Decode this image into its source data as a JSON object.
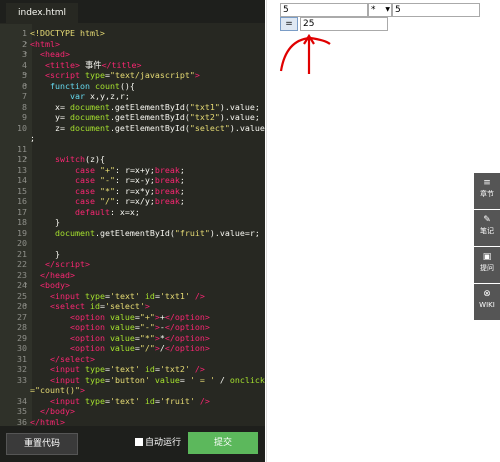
{
  "tab": {
    "filename": "index.html"
  },
  "code_lines": [
    {
      "num": "1",
      "fold": "",
      "html": "<span class=\"str\">&lt;!DOCTYPE html&gt;</span>"
    },
    {
      "num": "2",
      "fold": "▾",
      "html": "<span class=\"tag\">&lt;html&gt;</span>"
    },
    {
      "num": "3",
      "fold": "▾",
      "html": "  <span class=\"tag\">&lt;head&gt;</span>"
    },
    {
      "num": "4",
      "fold": "",
      "html": "   <span class=\"tag\">&lt;title&gt;</span> 事件<span class=\"tag\">&lt;/title&gt;</span>"
    },
    {
      "num": "5",
      "fold": "▾",
      "html": "   <span class=\"tag\">&lt;script</span> <span class=\"attr\">type</span>=<span class=\"str\">\"text/javascript\"</span><span class=\"tag\">&gt;</span>"
    },
    {
      "num": "6",
      "fold": "▾",
      "html": "    <span class=\"fn\">function</span> <span class=\"attr\">count</span>(){"
    },
    {
      "num": "7",
      "fold": "",
      "html": "        <span class=\"fn\">var</span> x,y,z,r;"
    },
    {
      "num": "8",
      "fold": "",
      "html": "     x= <span class=\"attr\">document</span>.getElementById(<span class=\"str\">\"txt1\"</span>).value;"
    },
    {
      "num": "9",
      "fold": "",
      "html": "     y= <span class=\"attr\">document</span>.getElementById(<span class=\"str\">\"txt2\"</span>).value;"
    },
    {
      "num": "10",
      "fold": "",
      "html": "     z= <span class=\"attr\">document</span>.getElementById(<span class=\"str\">\"select\"</span>).value"
    },
    {
      "num": "",
      "fold": "",
      "html": ";"
    },
    {
      "num": "11",
      "fold": "",
      "html": ""
    },
    {
      "num": "12",
      "fold": "▾",
      "html": "     <span class=\"tag\">switch</span>(z){"
    },
    {
      "num": "13",
      "fold": "",
      "html": "         <span class=\"tag\">case</span> <span class=\"str\">\"+\"</span>: r=x+y;<span class=\"tag\">break</span>;"
    },
    {
      "num": "14",
      "fold": "",
      "html": "         <span class=\"tag\">case</span> <span class=\"str\">\"-\"</span>: r=x-y;<span class=\"tag\">break</span>;"
    },
    {
      "num": "15",
      "fold": "",
      "html": "         <span class=\"tag\">case</span> <span class=\"str\">\"*\"</span>: r=x*y;<span class=\"tag\">break</span>;"
    },
    {
      "num": "16",
      "fold": "",
      "html": "         <span class=\"tag\">case</span> <span class=\"str\">\"/\"</span>: r=x/y;<span class=\"tag\">break</span>;"
    },
    {
      "num": "17",
      "fold": "",
      "html": "         <span class=\"tag\">default</span>: x=x;"
    },
    {
      "num": "18",
      "fold": "",
      "html": "     }"
    },
    {
      "num": "19",
      "fold": "",
      "html": "     <span class=\"attr\">document</span>.getElementById(<span class=\"str\">\"fruit\"</span>).value=r;"
    },
    {
      "num": "20",
      "fold": "",
      "html": ""
    },
    {
      "num": "21",
      "fold": "",
      "html": "     }"
    },
    {
      "num": "22",
      "fold": "",
      "html": "   <span class=\"tag\">&lt;/script&gt;</span>"
    },
    {
      "num": "23",
      "fold": "",
      "html": "  <span class=\"tag\">&lt;/head&gt;</span>"
    },
    {
      "num": "24",
      "fold": "▾",
      "html": "  <span class=\"tag\">&lt;body&gt;</span>"
    },
    {
      "num": "25",
      "fold": "",
      "html": "    <span class=\"tag\">&lt;input</span> <span class=\"attr\">type</span>=<span class=\"str\">'text'</span> <span class=\"attr\">id</span>=<span class=\"str\">'txt1'</span> <span class=\"tag\">/&gt;</span>"
    },
    {
      "num": "26",
      "fold": "▾",
      "html": "    <span class=\"tag\">&lt;select</span> <span class=\"attr\">id</span>=<span class=\"str\">'select'</span><span class=\"tag\">&gt;</span>"
    },
    {
      "num": "27",
      "fold": "",
      "html": "        <span class=\"tag\">&lt;option</span> <span class=\"attr\">value</span>=<span class=\"str\">\"+\"</span><span class=\"tag\">&gt;</span>+<span class=\"tag\">&lt;/option&gt;</span>"
    },
    {
      "num": "28",
      "fold": "",
      "html": "        <span class=\"tag\">&lt;option</span> <span class=\"attr\">value</span>=<span class=\"str\">\"-\"</span><span class=\"tag\">&gt;</span>-<span class=\"tag\">&lt;/option&gt;</span>"
    },
    {
      "num": "29",
      "fold": "",
      "html": "        <span class=\"tag\">&lt;option</span> <span class=\"attr\">value</span>=<span class=\"str\">\"*\"</span><span class=\"tag\">&gt;</span>*<span class=\"tag\">&lt;/option&gt;</span>"
    },
    {
      "num": "30",
      "fold": "",
      "html": "        <span class=\"tag\">&lt;option</span> <span class=\"attr\">value</span>=<span class=\"str\">\"/\"</span><span class=\"tag\">&gt;</span>/<span class=\"tag\">&lt;/option&gt;</span>"
    },
    {
      "num": "31",
      "fold": "",
      "html": "    <span class=\"tag\">&lt;/select&gt;</span>"
    },
    {
      "num": "32",
      "fold": "",
      "html": "    <span class=\"tag\">&lt;input</span> <span class=\"attr\">type</span>=<span class=\"str\">'text'</span> <span class=\"attr\">id</span>=<span class=\"str\">'txt2'</span> <span class=\"tag\">/&gt;</span>"
    },
    {
      "num": "33",
      "fold": "",
      "html": "    <span class=\"tag\">&lt;input</span> <span class=\"attr\">type</span>=<span class=\"str\">'button'</span> <span class=\"attr\">value</span>= <span class=\"str\">' = '</span> / <span class=\"attr\">onclick</span>"
    },
    {
      "num": "",
      "fold": "",
      "html": "<span class=\"str\">=\"count()\"</span><span class=\"tag\">&gt;</span>"
    },
    {
      "num": "34",
      "fold": "",
      "html": "    <span class=\"tag\">&lt;input</span> <span class=\"attr\">type</span>=<span class=\"str\">'text'</span> <span class=\"attr\">id</span>=<span class=\"str\">'fruit'</span> <span class=\"tag\">/&gt;</span>"
    },
    {
      "num": "35",
      "fold": "",
      "html": "  <span class=\"tag\">&lt;/body&gt;</span>"
    },
    {
      "num": "36",
      "fold": "",
      "html": "<span class=\"tag\">&lt;/html&gt;</span>"
    }
  ],
  "bottom": {
    "reset": "重置代码",
    "autorun": "自动运行",
    "submit": "提交"
  },
  "preview": {
    "txt1": "5",
    "select": "*",
    "txt2": "5",
    "eq": "=",
    "result": "25"
  },
  "sidetools": [
    {
      "icon": "≡",
      "label": "章节",
      "name": "chapters"
    },
    {
      "icon": "✎",
      "label": "笔记",
      "name": "notes"
    },
    {
      "icon": "▣",
      "label": "提问",
      "name": "questions"
    },
    {
      "icon": "⊗",
      "label": "WIKI",
      "name": "wiki"
    }
  ]
}
